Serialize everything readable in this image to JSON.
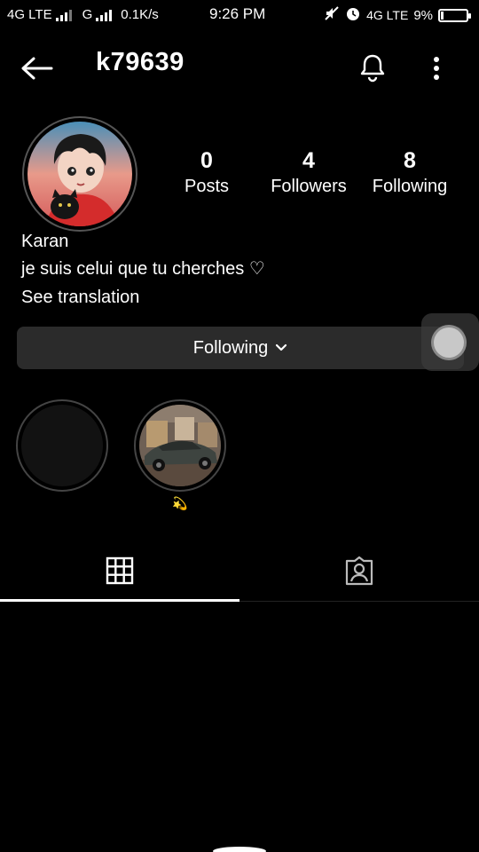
{
  "status_bar": {
    "network_1": "4G LTE",
    "network_2": "G",
    "speed": "0.1K/s",
    "time": "9:26 PM",
    "network_3": "4G LTE",
    "battery": "9%",
    "battery_level": 0.09
  },
  "header": {
    "username": "k79639"
  },
  "profile": {
    "posts_count": "0",
    "posts_label": "Posts",
    "followers_count": "4",
    "followers_label": "Followers",
    "following_count": "8",
    "following_label": "Following",
    "name": "Karan",
    "bio": "je suis celui que tu cherches ♡",
    "translation_link": "See translation"
  },
  "actions": {
    "following_button": "Following"
  },
  "highlights": [
    {
      "label": ""
    },
    {
      "label": "💫"
    }
  ],
  "tabs": [
    {
      "icon": "grid-icon",
      "selected": true
    },
    {
      "icon": "tagged-icon",
      "selected": false
    }
  ],
  "colors": {
    "background": "#000000",
    "button_bg": "#2b2b2b",
    "text": "#ffffff"
  }
}
